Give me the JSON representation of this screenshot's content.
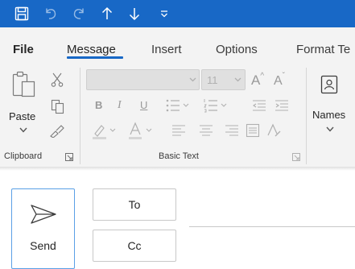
{
  "quick_access": {
    "icons": [
      "save-icon",
      "undo-icon",
      "redo-icon",
      "up-arrow-icon",
      "down-arrow-icon",
      "customize-icon"
    ]
  },
  "tabs": [
    {
      "label": "File"
    },
    {
      "label": "Message"
    },
    {
      "label": "Insert"
    },
    {
      "label": "Options"
    },
    {
      "label": "Format Te"
    }
  ],
  "active_tab": "Message",
  "ribbon": {
    "paste_label": "Paste",
    "font_size": "11",
    "bold": "B",
    "italic": "I",
    "underline": "U",
    "grow": "A",
    "shrink": "A",
    "names_label": "Names",
    "groups": {
      "clipboard": "Clipboard",
      "basic_text": "Basic Text"
    }
  },
  "compose": {
    "send_label": "Send",
    "to_label": "To",
    "cc_label": "Cc"
  },
  "colors": {
    "accent": "#1868c6",
    "ribbon_bg": "#f3f3f3"
  }
}
